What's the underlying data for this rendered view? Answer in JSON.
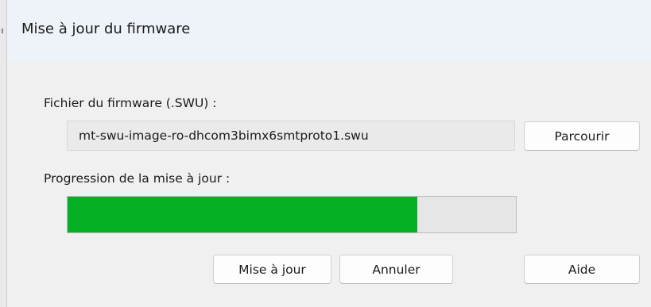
{
  "dialog": {
    "title": "Mise à jour du firmware"
  },
  "firmware": {
    "label": "Fichier du firmware (.SWU) :",
    "file_value": "mt-swu-image-ro-dhcom3bimx6smtproto1.swu",
    "browse_label": "Parcourir"
  },
  "progress": {
    "label": "Progression de la mise à jour :",
    "percent": 78,
    "fill_color": "#06b025"
  },
  "buttons": {
    "update_label": "Mise à jour",
    "cancel_label": "Annuler",
    "help_label": "Aide"
  }
}
